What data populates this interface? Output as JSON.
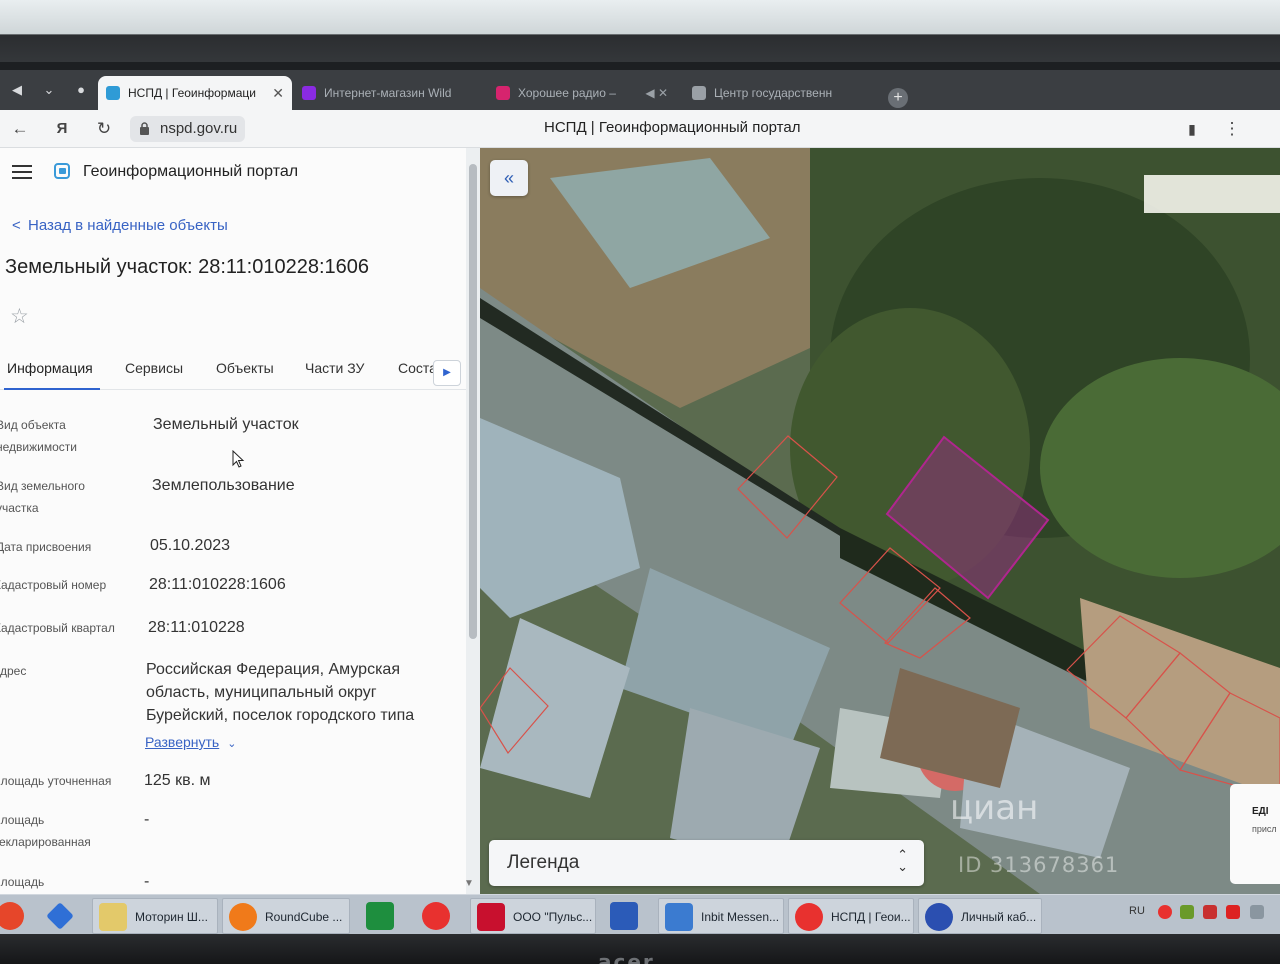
{
  "browser": {
    "tabs": [
      {
        "label": "НСПД | Геоинформаци",
        "active": true,
        "favicon_color": "#2f9bd6"
      },
      {
        "label": "Интернет-магазин Wild",
        "active": false,
        "favicon_color": "#8a2be2"
      },
      {
        "label": "Хорошее радио –",
        "active": false,
        "favicon_color": "#d6246e"
      },
      {
        "label": "Центр государственн",
        "active": false,
        "favicon_color": "#9aa0a6"
      }
    ],
    "url": "nspd.gov.ru",
    "page_title": "НСПД | Геоинформационный портал"
  },
  "app": {
    "portal_name": "Геоинформационный портал",
    "back_link": "Назад в найденные объекты",
    "object_title": "Земельный участок: 28:11:010228:1606",
    "tabs": [
      "Информация",
      "Сервисы",
      "Объекты",
      "Части ЗУ",
      "Соста"
    ],
    "fields": [
      {
        "label": "Вид объекта\nнедвижимости",
        "value": "Земельный участок"
      },
      {
        "label": "Вид земельного\nучастка",
        "value": "Землепользование"
      },
      {
        "label": "Дата присвоения",
        "value": "05.10.2023"
      },
      {
        "label": "Кадастровый номер",
        "value": "28:11:010228:1606"
      },
      {
        "label": "Кадастровый квартал",
        "value": "28:11:010228"
      },
      {
        "label": "Адрес",
        "value": "Российская Федерация, Амурская область, муниципальный округ Бурейский, поселок городского типа"
      },
      {
        "label": "Площадь уточненная",
        "value": "125 кв. м"
      },
      {
        "label": "Площадь\nдекларированная",
        "value": "-"
      },
      {
        "label": "Площадь",
        "value": "-"
      }
    ],
    "expand_link": "Развернуть",
    "legend_label": "Легенда",
    "side_card": {
      "line1": "ЕДІ",
      "line2": "присл"
    },
    "watermark": "циан",
    "watermark_id": "ID 313678361",
    "highlight_color": "#b0268f",
    "parcel_color": "#d8524a"
  },
  "taskbar": {
    "items": [
      {
        "label": "",
        "color": "#e6462a"
      },
      {
        "label": "",
        "color": "#2f6fd6"
      },
      {
        "label": "Моторин Ш...",
        "color": "#e3c96a"
      },
      {
        "label": "RoundCube ...",
        "color": "#f07a1a"
      },
      {
        "label": "",
        "color": "#1e8e3e"
      },
      {
        "label": "",
        "color": "#e8312f"
      },
      {
        "label": "ООО \"Пульс...",
        "color": "#c8102e"
      },
      {
        "label": "",
        "color": "#2b5bb8"
      },
      {
        "label": "Inbit Messen...",
        "color": "#3b7bd0"
      },
      {
        "label": "НСПД | Геои...",
        "color": "#e8312f"
      },
      {
        "label": "Личный каб...",
        "color": "#2b4fb0"
      }
    ],
    "tray_lang": "RU"
  }
}
